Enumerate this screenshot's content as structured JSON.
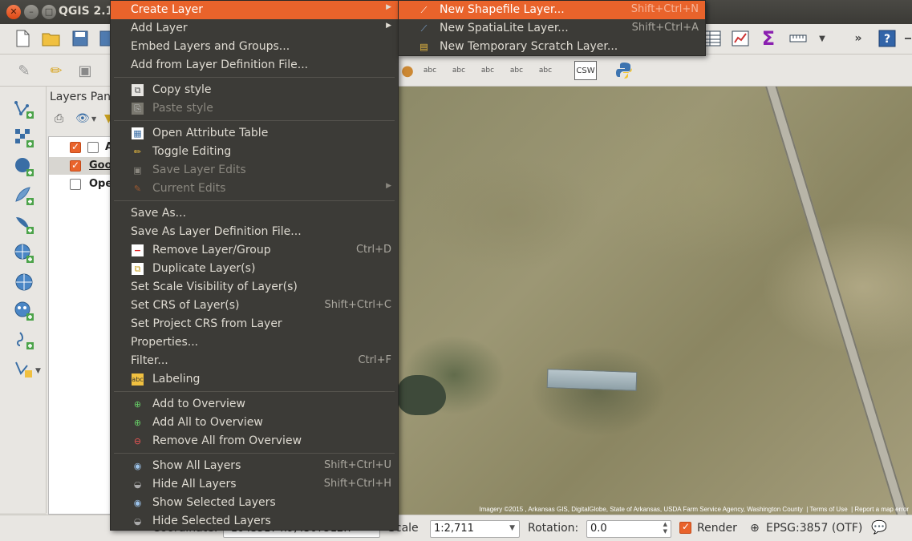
{
  "window": {
    "title": "QGIS 2.12"
  },
  "layers_panel": {
    "title": "Layers Panel",
    "layers": [
      {
        "name": "A",
        "visible": true,
        "selected": false
      },
      {
        "name": "Goo",
        "visible": true,
        "selected": true
      },
      {
        "name": "Ope",
        "visible": false,
        "selected": false
      }
    ]
  },
  "context_menu": {
    "items": [
      {
        "label": "Create Layer",
        "submenu": true,
        "highlighted": true
      },
      {
        "label": "Add Layer",
        "submenu": true
      },
      {
        "label": "Embed Layers and Groups..."
      },
      {
        "label": "Add from Layer Definition File..."
      },
      {
        "label": "Copy style",
        "icon": "copy-style-icon"
      },
      {
        "label": "Paste style",
        "icon": "paste-style-icon",
        "disabled": true
      },
      {
        "label": "Open Attribute Table",
        "icon": "attribute-table-icon"
      },
      {
        "label": "Toggle Editing",
        "icon": "pencil-icon"
      },
      {
        "label": "Save Layer Edits",
        "icon": "save-edits-icon",
        "disabled": true
      },
      {
        "label": "Current Edits",
        "icon": "current-edits-icon",
        "disabled": true,
        "submenu": true
      },
      {
        "label": "Save As..."
      },
      {
        "label": "Save As Layer Definition File..."
      },
      {
        "label": "Remove Layer/Group",
        "icon": "remove-layer-icon",
        "shortcut": "Ctrl+D"
      },
      {
        "label": "Duplicate Layer(s)",
        "icon": "duplicate-layer-icon"
      },
      {
        "label": "Set Scale Visibility of Layer(s)"
      },
      {
        "label": "Set CRS of Layer(s)",
        "shortcut": "Shift+Ctrl+C"
      },
      {
        "label": "Set Project CRS from Layer"
      },
      {
        "label": "Properties..."
      },
      {
        "label": "Filter...",
        "shortcut": "Ctrl+F"
      },
      {
        "label": "Labeling",
        "icon": "labeling-icon"
      },
      {
        "label": "Add to Overview",
        "icon": "add-overview-icon"
      },
      {
        "label": "Add All to Overview",
        "icon": "add-all-overview-icon"
      },
      {
        "label": "Remove All from Overview",
        "icon": "remove-overview-icon"
      },
      {
        "label": "Show All Layers",
        "icon": "eye-icon",
        "shortcut": "Shift+Ctrl+U"
      },
      {
        "label": "Hide All Layers",
        "icon": "eye-closed-icon",
        "shortcut": "Shift+Ctrl+H"
      },
      {
        "label": "Show Selected Layers",
        "icon": "eye-icon"
      },
      {
        "label": "Hide Selected Layers",
        "icon": "eye-closed-icon"
      }
    ]
  },
  "submenu": {
    "items": [
      {
        "label": "New Shapefile Layer...",
        "shortcut": "Shift+Ctrl+N",
        "icon": "new-shapefile-icon",
        "highlighted": true
      },
      {
        "label": "New SpatiaLite Layer...",
        "shortcut": "Shift+Ctrl+A",
        "icon": "new-spatialite-icon"
      },
      {
        "label": "New Temporary Scratch Layer...",
        "icon": "new-scratch-layer-icon"
      }
    ]
  },
  "toolbar2": {
    "csw_label": "CSW"
  },
  "map": {
    "attribution": "Imagery ©2015 , Arkansas GIS, DigitalGlobe, State of Arkansas, USDA Farm Service Agency, Washington County",
    "terms": "Terms of Use",
    "report": "Report a map error"
  },
  "statusbar": {
    "coordinate_label": "Coordinate:",
    "coordinate_value": "-10435174.9,4307512.7",
    "scale_label": "Scale",
    "scale_value": "1:2,711",
    "rotation_label": "Rotation:",
    "rotation_value": "0.0",
    "render_label": "Render",
    "crs_label": "EPSG:3857 (OTF)"
  }
}
